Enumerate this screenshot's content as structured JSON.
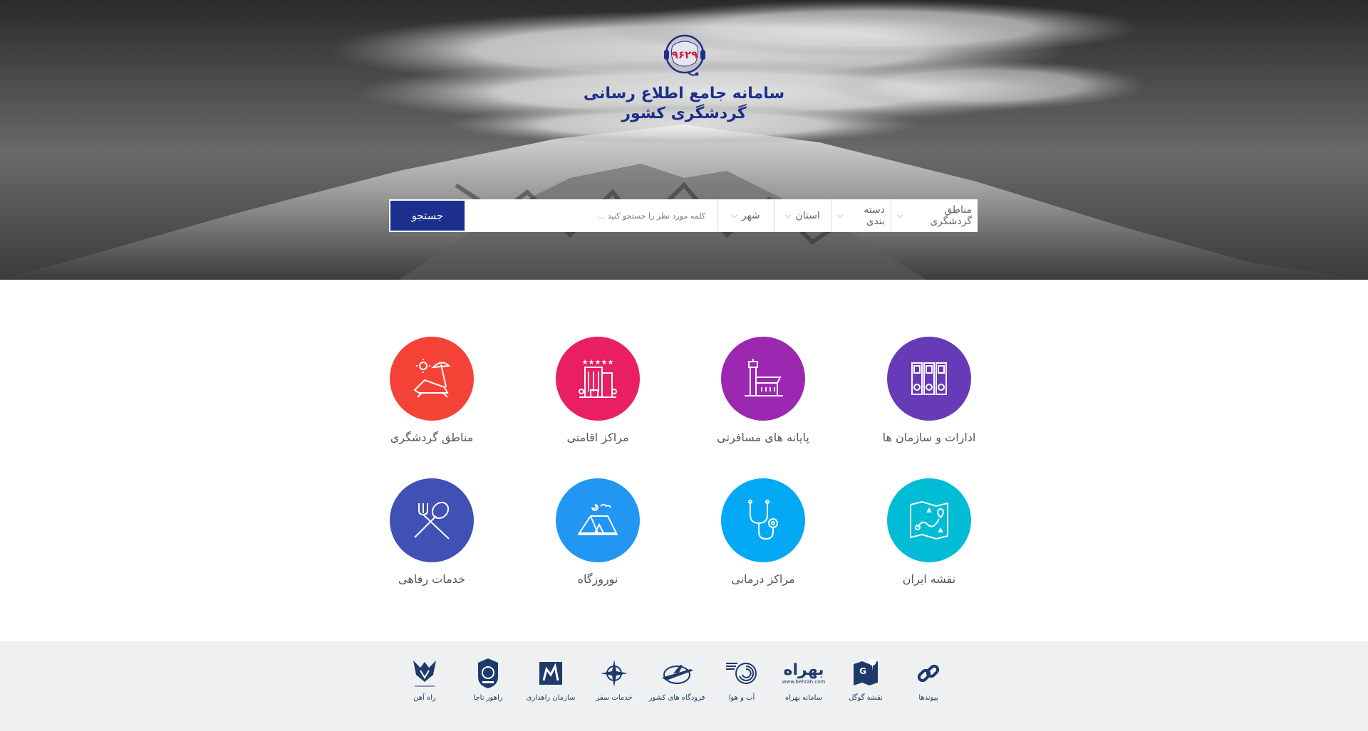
{
  "header": {
    "logo_text": "۹۶۲۹",
    "title_line1": "سامانه جامع اطلاع رسانی",
    "title_line2": "گردشگری کشور"
  },
  "search": {
    "filters": [
      "مناطق گردشگری",
      "دسته بندی",
      "استان",
      "شهر"
    ],
    "placeholder": "کلمه مورد نظر را جستجو کنید ...",
    "button_label": "جستجو"
  },
  "categories": [
    {
      "label": "اادارات و سازمان ها",
      "color": "#673ab7",
      "icon": "office-buildings-icon"
    },
    {
      "label": "پایانه های مسافرتی",
      "color": "#9c27b0",
      "icon": "airport-terminal-icon"
    },
    {
      "label": "مراکز اقامتی",
      "color": "#e91e63",
      "icon": "hotel-icon"
    },
    {
      "label": "مناطق گردشگری",
      "color": "#f44336",
      "icon": "beach-umbrella-icon"
    },
    {
      "label": "نقشه ایران",
      "color": "#00bcd4",
      "icon": "map-icon"
    },
    {
      "label": "مراکز درمانی",
      "color": "#03a9f4",
      "icon": "stethoscope-icon"
    },
    {
      "label": "نوروزگاه",
      "color": "#2196f3",
      "icon": "tent-icon"
    },
    {
      "label": "خدمات رفاهی",
      "color": "#3f51b5",
      "icon": "fork-spoon-icon"
    }
  ],
  "footer_links": [
    {
      "label": "پیوندها",
      "icon": "link-icon"
    },
    {
      "label": "نقشه گوگل",
      "icon": "google-map-icon"
    },
    {
      "label": "سامانه بهراه",
      "icon": "behrah-logo-icon",
      "logo_text": "بهراه",
      "logo_sub": "www.behrah.com"
    },
    {
      "label": "آب و هوا",
      "icon": "weather-logo-icon"
    },
    {
      "label": "فرودگاه های کشور",
      "icon": "airports-logo-icon"
    },
    {
      "label": "خدمات سفر",
      "icon": "compass-icon"
    },
    {
      "label": "سازمان راهداری",
      "icon": "road-org-logo-icon"
    },
    {
      "label": "راهور ناجا",
      "icon": "police-badge-icon"
    },
    {
      "label": "راه آهن",
      "icon": "railway-logo-icon"
    }
  ],
  "colors": {
    "brand_blue": "#1d2f8c",
    "footer_bg": "#eef0f2",
    "footer_text": "#1d3a6a"
  }
}
